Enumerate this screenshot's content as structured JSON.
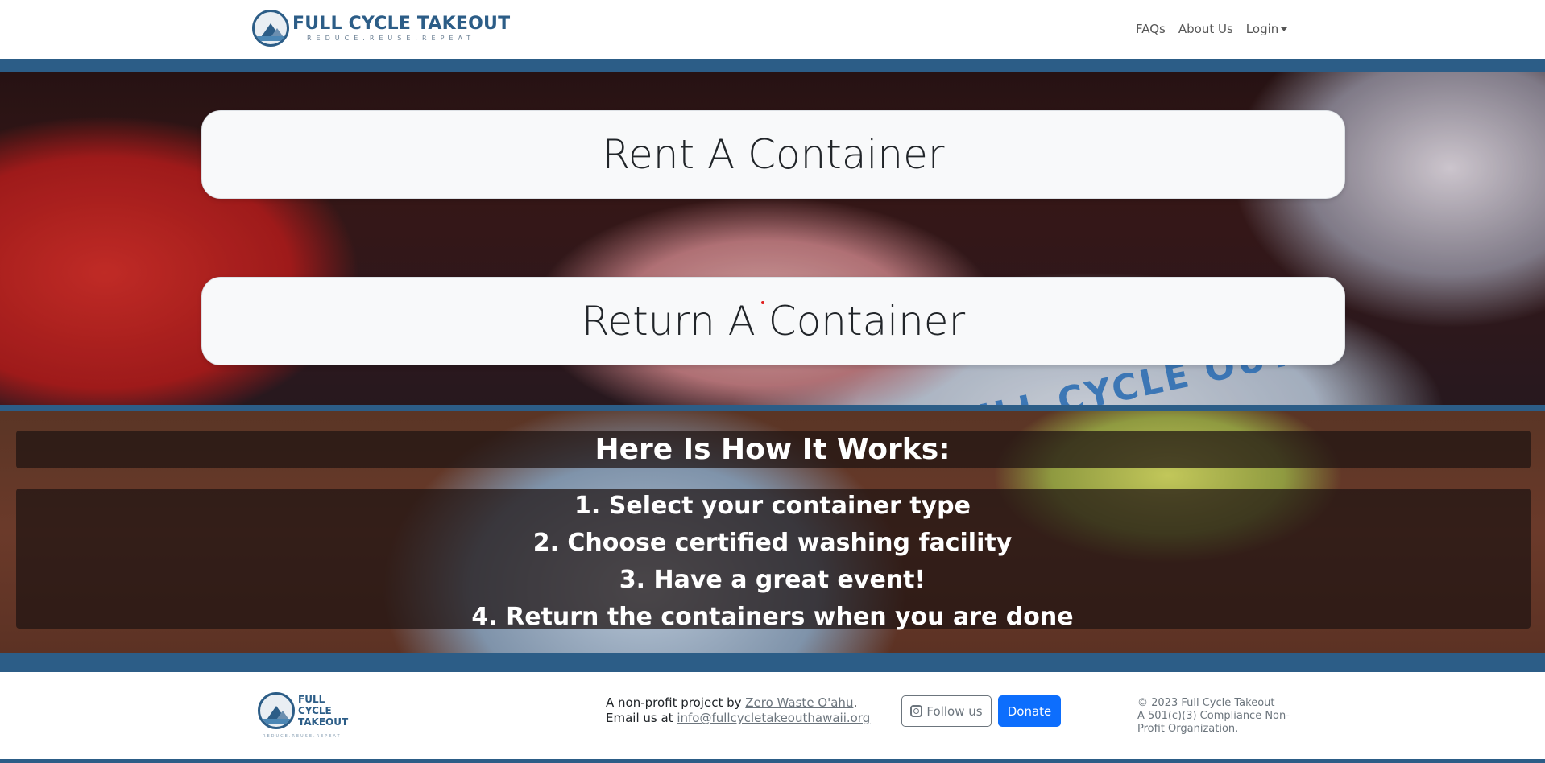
{
  "navbar": {
    "brand_title": "FULL CYCLE TAKEOUT",
    "brand_tagline": "REDUCE.REUSE.REPEAT",
    "links": [
      {
        "label": "FAQs"
      },
      {
        "label": "About Us"
      },
      {
        "label": "Login"
      }
    ]
  },
  "hero": {
    "rent_label": "Rent A Container",
    "return_label": "Return A Container",
    "background_text": "FULL CYCLE OUT"
  },
  "how": {
    "title": "Here Is How It Works:",
    "steps": [
      "1. Select your container type",
      "2. Choose certified washing facility",
      "3. Have a great event!",
      "4. Return the containers when you are done"
    ]
  },
  "footer": {
    "logo_line1": "FULL",
    "logo_line2": "CYCLE",
    "logo_line3": "TAKEOUT",
    "logo_tagline": "REDUCE.REUSE.REPEAT",
    "about_prefix": "A non-profit project by ",
    "about_link": "Zero Waste O'ahu",
    "about_suffix": ".",
    "email_prefix": "Email us at ",
    "email_link": "info@fullcycletakeouthawaii.org",
    "follow_label": "Follow us",
    "donate_label": "Donate",
    "copyright": "© 2023 Full Cycle Takeout",
    "legal": "A 501(c)(3) Compliance Non-Profit Organization."
  },
  "colors": {
    "brand_blue": "#2c5d87",
    "donate_blue": "#0d6efd"
  }
}
